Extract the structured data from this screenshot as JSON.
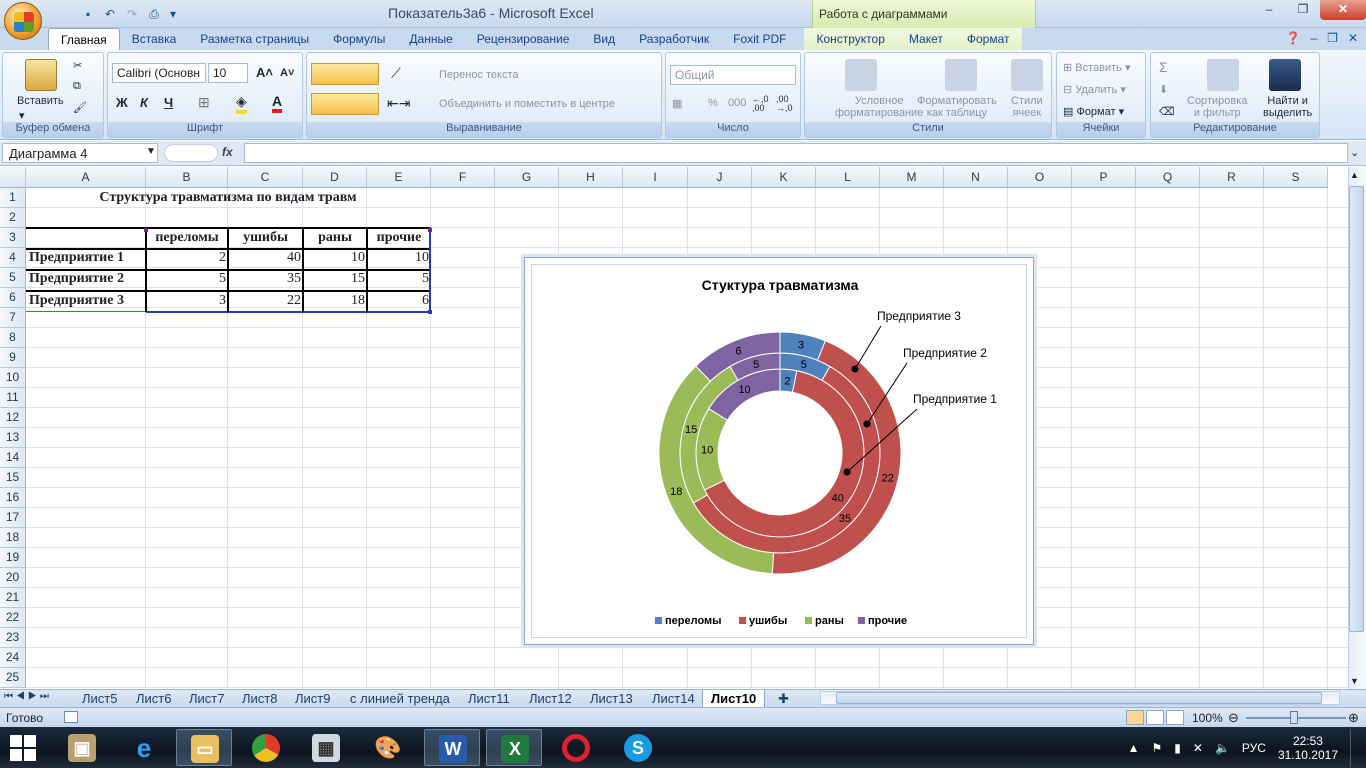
{
  "window": {
    "title": "Показатель3а6 - Microsoft Excel",
    "context_title": "Работа с диаграммами",
    "minimize": "–",
    "restore": "❐",
    "close": "✕"
  },
  "ribbon_tabs": [
    "Главная",
    "Вставка",
    "Разметка страницы",
    "Формулы",
    "Данные",
    "Рецензирование",
    "Вид",
    "Разработчик",
    "Foxit PDF",
    "Конструктор",
    "Макет",
    "Формат"
  ],
  "ribbon": {
    "clipboard": {
      "title": "Буфер обмена",
      "paste": "Вставить"
    },
    "font": {
      "title": "Шрифт",
      "name": "Calibri (Основн",
      "size": "10",
      "bold": "Ж",
      "italic": "К",
      "underline": "Ч"
    },
    "align": {
      "title": "Выравнивание",
      "wrap": "Перенос текста",
      "merge": "Объединить и поместить в центре"
    },
    "number": {
      "title": "Число",
      "format": "Общий",
      "percent": "%",
      "thousands": "000"
    },
    "styles": {
      "title": "Стили",
      "cond1": "Условное",
      "cond2": "форматирование",
      "table1": "Форматировать",
      "table2": "как таблицу",
      "cell1": "Стили",
      "cell2": "ячеек"
    },
    "cells": {
      "title": "Ячейки",
      "insert": "Вставить",
      "delete": "Удалить",
      "format": "Формат"
    },
    "editing": {
      "title": "Редактирование",
      "sort1": "Сортировка",
      "sort2": "и фильтр",
      "find1": "Найти и",
      "find2": "выделить",
      "sigma": "Σ"
    }
  },
  "formula_bar": {
    "name_box": "Диаграмма 4",
    "fx": "fx",
    "value": ""
  },
  "columns": [
    "A",
    "B",
    "C",
    "D",
    "E",
    "F",
    "G",
    "H",
    "I",
    "J",
    "K",
    "L",
    "M",
    "N",
    "O",
    "P",
    "Q",
    "R",
    "S"
  ],
  "rows": [
    "1",
    "2",
    "3",
    "4",
    "5",
    "6",
    "7",
    "8",
    "9",
    "10",
    "11",
    "12",
    "13",
    "14",
    "15",
    "16",
    "17",
    "18",
    "19",
    "20",
    "21",
    "22",
    "23",
    "24",
    "25"
  ],
  "sheet": {
    "title": "Структура травматизма по видам травм",
    "headers": [
      "переломы",
      "ушибы",
      "раны",
      "прочие"
    ],
    "table": [
      {
        "name": "Предприятие 1",
        "values": [
          "2",
          "40",
          "10",
          "10"
        ]
      },
      {
        "name": "Предприятие 2",
        "values": [
          "5",
          "35",
          "15",
          "5"
        ]
      },
      {
        "name": "Предприятие 3",
        "values": [
          "3",
          "22",
          "18",
          "6"
        ]
      }
    ]
  },
  "chart_data": {
    "type": "doughnut",
    "title": "Стуктура травматизма",
    "categories": [
      "переломы",
      "ушибы",
      "раны",
      "прочие"
    ],
    "colors": [
      "#4f81bd",
      "#c0504d",
      "#9bbb59",
      "#8064a2"
    ],
    "series": [
      {
        "name": "Предприятие 1",
        "values": [
          2,
          40,
          10,
          10
        ]
      },
      {
        "name": "Предприятие 2",
        "values": [
          5,
          35,
          15,
          5
        ]
      },
      {
        "name": "Предприятие 3",
        "values": [
          3,
          22,
          18,
          6
        ]
      }
    ],
    "legend_position": "bottom"
  },
  "sheet_tabs": [
    "Лист5",
    "Лист6",
    "Лист7",
    "Лист8",
    "Лист9",
    "с линией тренда",
    "Лист11",
    "Лист12",
    "Лист13",
    "Лист14",
    "Лист10"
  ],
  "active_sheet": "Лист10",
  "status": {
    "ready": "Готово",
    "zoom": "100%"
  },
  "taskbar": {
    "lang": "РУС",
    "time": "22:53",
    "date": "31.10.2017"
  }
}
